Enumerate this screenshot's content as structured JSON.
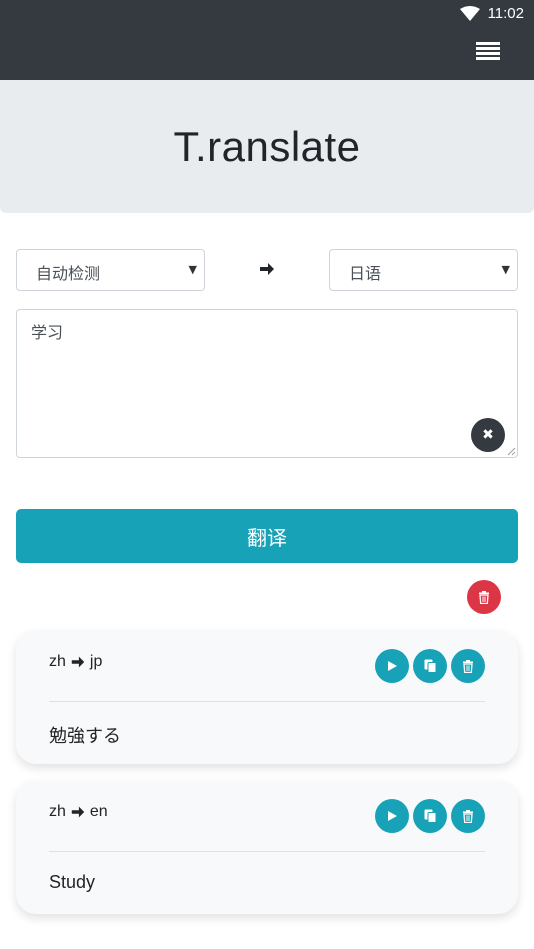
{
  "status_bar": {
    "time": "11:02",
    "wifi_icon": "wifi-icon"
  },
  "navbar": {
    "menu_icon": "hamburger-menu-icon"
  },
  "header": {
    "title": "T.ranslate"
  },
  "form": {
    "source_lang": "自动检测",
    "target_lang": "日语",
    "input_text": "学习",
    "translate_label": "翻译"
  },
  "history": [
    {
      "from": "zh",
      "to": "jp",
      "result": "勉強する"
    },
    {
      "from": "zh",
      "to": "en",
      "result": "Study"
    }
  ],
  "colors": {
    "navbar": "#343a40",
    "primary": "#17a2b8",
    "danger": "#dc3545",
    "jumbotron": "#e9ecef"
  }
}
